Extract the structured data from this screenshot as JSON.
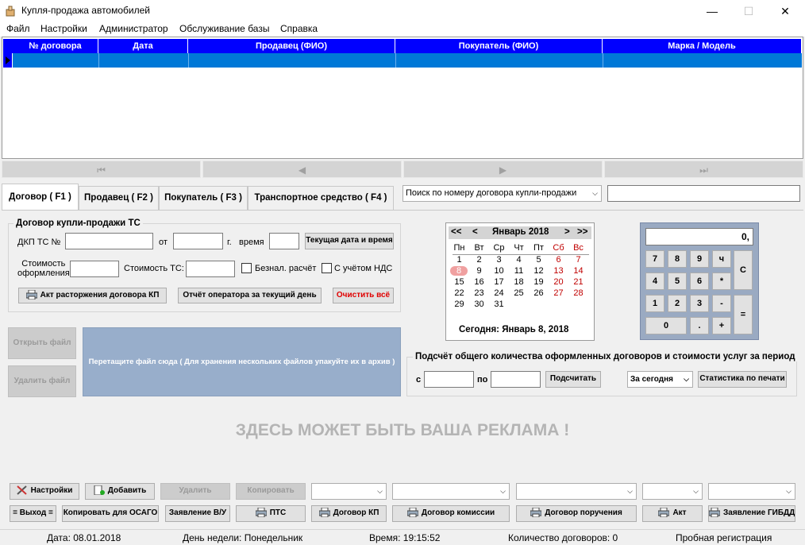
{
  "window": {
    "title": "Купля-продажа автомобилей"
  },
  "menu": [
    "Файл",
    "Настройки",
    "Администратор",
    "Обслуживание базы",
    "Справка"
  ],
  "grid": {
    "columns": [
      "№ договора",
      "Дата",
      "Продавец (ФИО)",
      "Покупатель (ФИО)",
      "Марка / Модель"
    ]
  },
  "tabs": [
    "Договор ( F1 )",
    "Продавец ( F2 )",
    "Покупатель ( F3 )",
    "Транспортное средство ( F4 )"
  ],
  "search": {
    "combo": "Поиск по номеру договора купли-продажи",
    "value": ""
  },
  "contract": {
    "group_title": "Договор купли-продажи ТС",
    "dkp_label": "ДКП ТС №",
    "from_label": "от",
    "year_label": "г.",
    "time_label": "время",
    "now_button": "Текущая дата и время",
    "reg_cost_label": "Стоимость оформления",
    "reg_cost_line1": "Стоимость",
    "reg_cost_line2": "оформления",
    "vehicle_cost_label": "Стоимость ТС:",
    "cashless_label": "Безнал. расчёт",
    "vat_label": "С учётом НДС",
    "act_button": "Акт расторжения договора КП",
    "report_button": "Отчёт оператора за текущий день",
    "clear_button": "Очистить всё"
  },
  "files": {
    "open_button": "Открыть файл",
    "delete_button": "Удалить файл",
    "drop_text": "Перетащите файл сюда ( Для хранения нескольких файлов упакуйте их в архив )"
  },
  "calendar": {
    "prev_year": "<<",
    "prev_month": "<",
    "month_title": "Январь 2018",
    "next_month": ">",
    "next_year": ">>",
    "weekdays": [
      "Пн",
      "Вт",
      "Ср",
      "Чт",
      "Пт",
      "Сб",
      "Вс"
    ],
    "weeks": [
      [
        "1",
        "2",
        "3",
        "4",
        "5",
        "6",
        "7"
      ],
      [
        "8",
        "9",
        "10",
        "11",
        "12",
        "13",
        "14"
      ],
      [
        "15",
        "16",
        "17",
        "18",
        "19",
        "20",
        "21"
      ],
      [
        "22",
        "23",
        "24",
        "25",
        "26",
        "27",
        "28"
      ],
      [
        "29",
        "30",
        "31",
        "",
        "",
        "",
        ""
      ]
    ],
    "today_label": "Сегодня:",
    "today_value": "Январь 8, 2018",
    "selected_day": "8"
  },
  "calculator": {
    "display": "0,",
    "keys": [
      [
        "7",
        "8",
        "9",
        "ч"
      ],
      [
        "4",
        "5",
        "6",
        "*"
      ],
      [
        "1",
        "2",
        "3",
        "-"
      ],
      [
        "0",
        "",
        ".",
        "+"
      ]
    ],
    "clear_key": "C",
    "equals_key": "="
  },
  "period": {
    "title": "Подсчёт общего количества оформленных договоров и стоимости услуг за период",
    "from_label": "с",
    "to_label": "по",
    "count_button": "Подсчитать",
    "range_combo": "За сегодня",
    "print_button": "Статистика по печати"
  },
  "ad_text": "ЗДЕСЬ МОЖЕТ БЫТЬ ВАША РЕКЛАМА !",
  "toolbar": {
    "settings": "Настройки",
    "add": "Добавить",
    "delete": "Удалить",
    "copy": "Копировать",
    "exit": "= Выход =",
    "copy_osago": "Копировать для ОСАГО",
    "license_app": "Заявление В/У",
    "pts": "ПТС",
    "contract_kp": "Договор КП",
    "commission": "Договор комиссии",
    "assignment": "Договор поручения",
    "act": "Акт",
    "gibdd_app": "Заявление ГИБДД"
  },
  "status": {
    "date": "Дата: 08.01.2018",
    "weekday": "День недели: Понедельник",
    "time": "Время: 19:15:52",
    "count": "Количество договоров: 0",
    "registration": "Пробная регистрация"
  },
  "colors": {
    "grid_header": "#0000ff",
    "selected_row": "#0078d7",
    "calc_bg": "#9aaac2",
    "clear_button_text": "#e00000",
    "weekend": "#c00000"
  }
}
